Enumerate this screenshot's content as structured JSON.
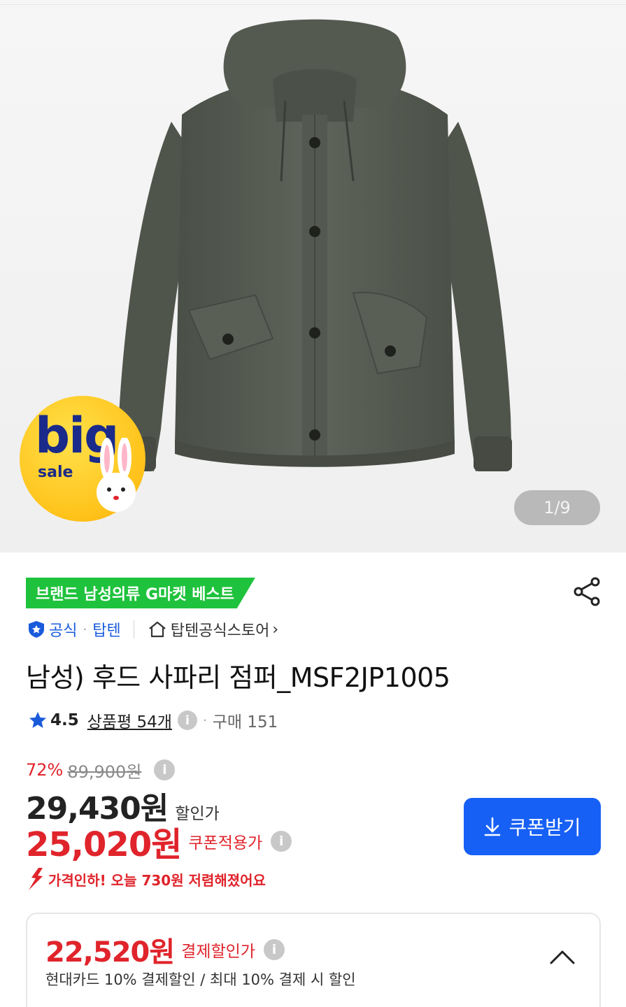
{
  "gallery": {
    "pager_text": "1/9",
    "sale_badge": {
      "big": "big",
      "sale": "sale"
    }
  },
  "product": {
    "badge": "브랜드 남성의류 G마켓 베스트",
    "official_label": "공식",
    "brand": "탑텐",
    "store_link": "탑텐공식스토어",
    "title": "남성) 후드 사파리 점퍼_MSF2JP1005",
    "rating": "4.5",
    "review_link": "상품평 54개",
    "purchases": "구매 151"
  },
  "pricing": {
    "discount_percent": "72%",
    "original_price": "89,900원",
    "sale_price": "29,430원",
    "sale_label": "할인가",
    "coupon_price": "25,020원",
    "coupon_label": "쿠폰적용가",
    "coupon_button": "쿠폰받기",
    "price_drop_note": "가격인하! 오늘 730원 저렴해졌어요",
    "info_glyph": "i"
  },
  "payment": {
    "price": "22,520원",
    "label": "결제할인가",
    "description": "현대카드 10% 결제할인 / 최대 10% 결제 시 할인"
  },
  "colors": {
    "accent_red": "#e0242b",
    "brand_blue": "#1760f5",
    "badge_green": "#1fc23c",
    "link_blue": "#1a5bdb"
  },
  "icons": {
    "share": "share-icon",
    "shield": "shield-check-icon",
    "home": "home-icon",
    "star": "star-icon",
    "download": "download-icon",
    "down_arrow": "price-down-arrow-icon",
    "chevron_up": "chevron-up-icon"
  }
}
